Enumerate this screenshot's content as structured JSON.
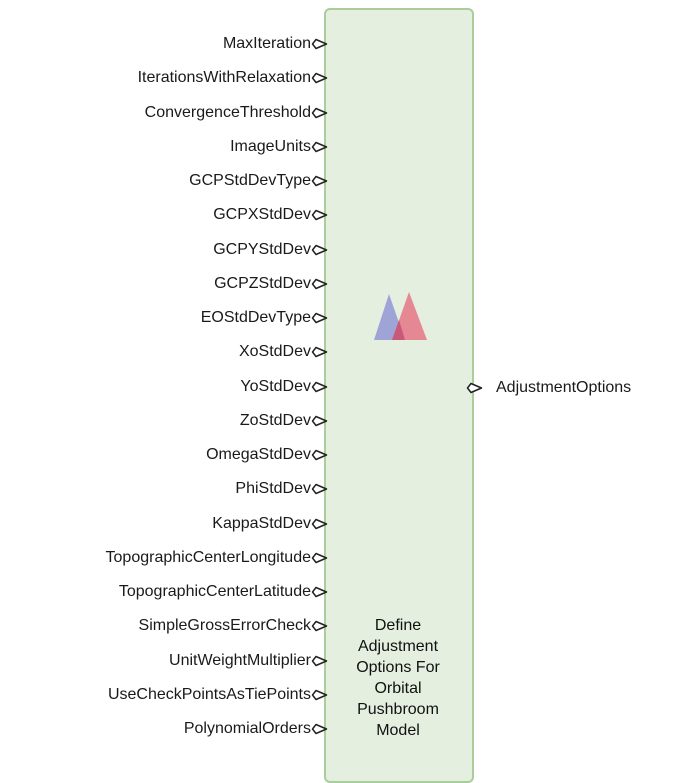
{
  "node": {
    "title_lines": [
      "Define",
      "Adjustment",
      "Options For",
      "Orbital",
      "Pushbroom",
      "Model"
    ],
    "colors": {
      "fill": "#e4efdf",
      "border": "#a9cd9b",
      "logo_left": "#9b9fd6",
      "logo_right": "#e6818f",
      "logo_overlap": "#c65a78"
    },
    "logo_icon": "app-logo-icon",
    "port_icon": "port-connector-icon"
  },
  "inputs": [
    "MaxIteration",
    "IterationsWithRelaxation",
    "ConvergenceThreshold",
    "ImageUnits",
    "GCPStdDevType",
    "GCPXStdDev",
    "GCPYStdDev",
    "GCPZStdDev",
    "EOStdDevType",
    "XoStdDev",
    "YoStdDev",
    "ZoStdDev",
    "OmegaStdDev",
    "PhiStdDev",
    "KappaStdDev",
    "TopographicCenterLongitude",
    "TopographicCenterLatitude",
    "SimpleGrossErrorCheck",
    "UnitWeightMultiplier",
    "UseCheckPointsAsTiePoints",
    "PolynomialOrders"
  ],
  "outputs": [
    "AdjustmentOptions"
  ]
}
